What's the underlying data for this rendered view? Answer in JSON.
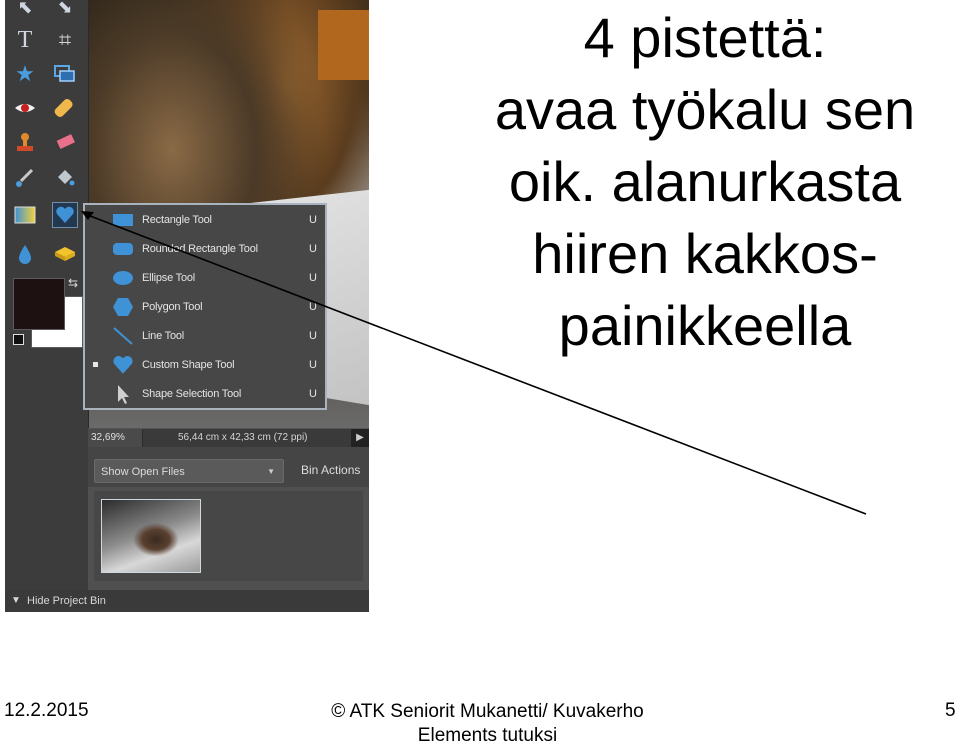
{
  "slide": {
    "title_lines": [
      "4 pistettä:",
      "avaa työkalu sen",
      "oik. alanurkasta",
      "hiiren kakkos-",
      "painikkeella"
    ],
    "footer": {
      "date": "12.2.2015",
      "center_line1": "© ATK Seniorit Mukanetti/ Kuvakerho",
      "center_line2": "Elements tutuksi",
      "page_number": "5"
    }
  },
  "editor": {
    "toolbox": {
      "tools": [
        "move-tool",
        "zoom-tool",
        "type-tool",
        "crop-tool",
        "cookie-cutter-tool",
        "recompose-tool",
        "red-eye-tool",
        "healing-brush-tool",
        "clone-stamp-tool",
        "eraser-tool",
        "brush-tool",
        "paint-bucket-tool",
        "gradient-tool",
        "custom-shape-tool",
        "blur-tool",
        "sponge-tool"
      ],
      "foreground_color": "#1d1211",
      "background_color": "#ffffff"
    },
    "shape_menu": {
      "items": [
        {
          "label": "Rectangle Tool",
          "shortcut": "U",
          "icon": "rectangle-shape-icon",
          "checked": false
        },
        {
          "label": "Rounded Rectangle Tool",
          "shortcut": "U",
          "icon": "rounded-rectangle-shape-icon",
          "checked": false
        },
        {
          "label": "Ellipse Tool",
          "shortcut": "U",
          "icon": "ellipse-shape-icon",
          "checked": false
        },
        {
          "label": "Polygon Tool",
          "shortcut": "U",
          "icon": "polygon-shape-icon",
          "checked": false
        },
        {
          "label": "Line Tool",
          "shortcut": "U",
          "icon": "line-shape-icon",
          "checked": false
        },
        {
          "label": "Custom Shape Tool",
          "shortcut": "U",
          "icon": "heart-shape-icon",
          "checked": true
        },
        {
          "label": "Shape Selection Tool",
          "shortcut": "U",
          "icon": "arrow-pointer-icon",
          "checked": false
        }
      ]
    },
    "statusbar": {
      "zoom": "32,69%",
      "doc_size": "56,44 cm x 42,33 cm (72 ppi)"
    },
    "project_bin": {
      "select_value": "Show Open Files",
      "actions_label": "Bin Actions",
      "hide_label": "Hide Project Bin"
    },
    "accent_color": "#3f92d6"
  }
}
